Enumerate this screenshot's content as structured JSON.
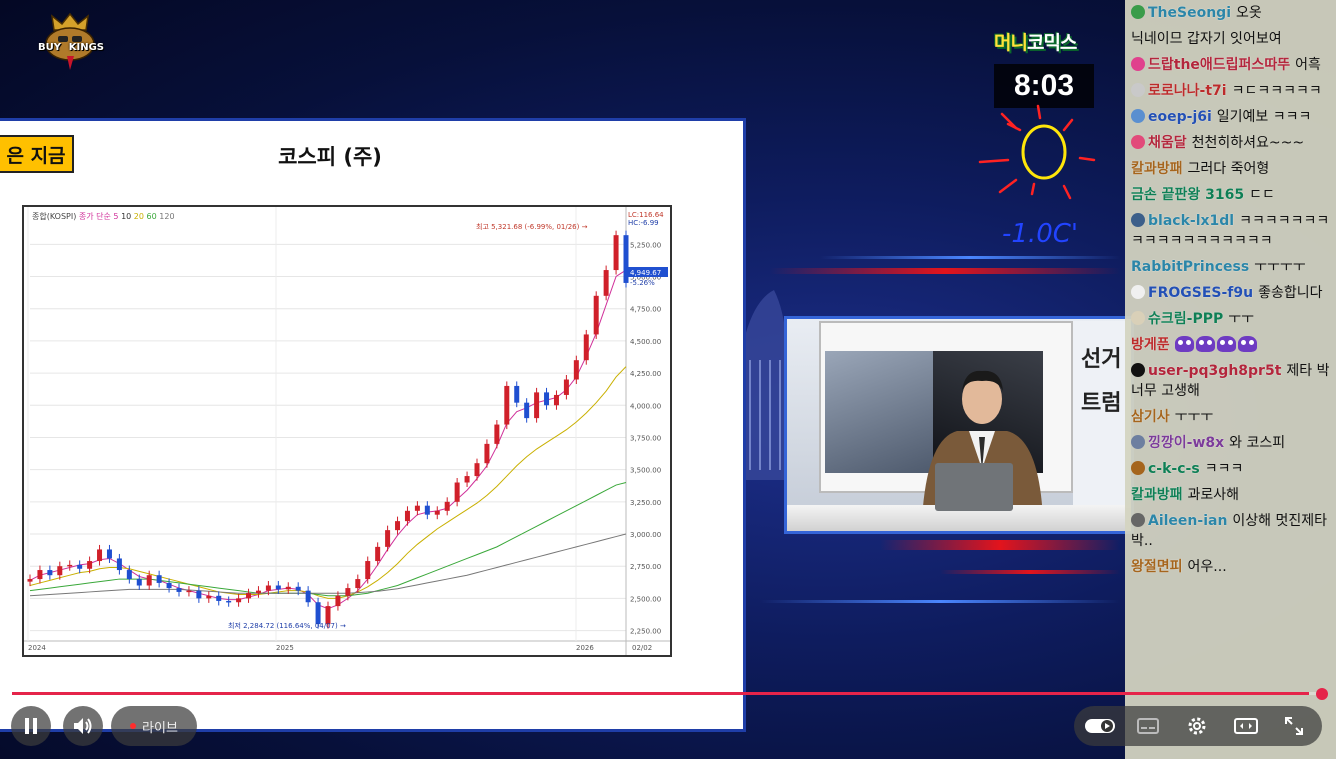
{
  "channel": {
    "logo_left": "BUY",
    "logo_right": "KINGS",
    "brand_prefix": "머니",
    "brand_suffix": "코믹스",
    "clock": "8:03"
  },
  "slide": {
    "tag": "은 지금",
    "title": "코스피 (주)",
    "legend": {
      "name": "종합(KOSPI)",
      "ma_label": "종가 단순",
      "ma5": "5",
      "ma10": "10",
      "ma20": "20",
      "ma60": "60",
      "ma120": "120"
    },
    "high_note": "최고 5,321.68 (-6.99%, 01/26) →",
    "low_note": "최저 2,284.72 (116.64%, 04/07) →",
    "top_right_1": "LC:116.64",
    "top_right_2": "HC:-6.99",
    "current_price": "4,949.67",
    "current_change": "-5.26%"
  },
  "chart_data": {
    "type": "line",
    "title": "코스피 (주)",
    "xlabel": "",
    "ylabel": "",
    "x_ticks": [
      "2024",
      "2025",
      "2026",
      "02/02"
    ],
    "y_ticks": [
      "5,250.00",
      "5,000.00",
      "4,750.00",
      "4,500.00",
      "4,250.00",
      "4,000.00",
      "3,750.00",
      "3,500.00",
      "3,250.00",
      "3,000.00",
      "2,750.00",
      "2,500.00",
      "2,250.00"
    ],
    "ylim": [
      2200,
      5400
    ],
    "grid": true,
    "series": [
      {
        "name": "종합(KOSPI)",
        "values": [
          2650,
          2720,
          2680,
          2750,
          2760,
          2730,
          2790,
          2880,
          2810,
          2720,
          2650,
          2600,
          2680,
          2620,
          2580,
          2550,
          2560,
          2500,
          2520,
          2480,
          2470,
          2500,
          2540,
          2560,
          2600,
          2570,
          2590,
          2560,
          2470,
          2300,
          2440,
          2520,
          2580,
          2650,
          2790,
          2900,
          3030,
          3100,
          3180,
          3220,
          3150,
          3180,
          3250,
          3400,
          3450,
          3550,
          3700,
          3850,
          4150,
          4020,
          3900,
          4100,
          4000,
          4080,
          4200,
          4350,
          4550,
          4850,
          5050,
          5321,
          4950
        ]
      },
      {
        "name": "5",
        "values": [
          2640,
          2680,
          2700,
          2720,
          2740,
          2760,
          2770,
          2800,
          2810,
          2770,
          2720,
          2670,
          2650,
          2640,
          2610,
          2580,
          2560,
          2540,
          2520,
          2500,
          2490,
          2490,
          2510,
          2530,
          2560,
          2570,
          2580,
          2570,
          2530,
          2450,
          2420,
          2450,
          2500,
          2560,
          2650,
          2760,
          2880,
          2990,
          3080,
          3150,
          3170,
          3180,
          3200,
          3270,
          3340,
          3430,
          3530,
          3680,
          3860,
          3950,
          3980,
          4020,
          4040,
          4060,
          4120,
          4220,
          4380,
          4560,
          4780,
          5000,
          5050
        ]
      },
      {
        "name": "20",
        "values": [
          2600,
          2620,
          2640,
          2660,
          2680,
          2700,
          2710,
          2730,
          2740,
          2740,
          2730,
          2710,
          2690,
          2670,
          2650,
          2630,
          2610,
          2590,
          2570,
          2550,
          2540,
          2530,
          2530,
          2530,
          2540,
          2550,
          2560,
          2560,
          2550,
          2520,
          2500,
          2500,
          2520,
          2550,
          2590,
          2640,
          2700,
          2770,
          2850,
          2920,
          2980,
          3040,
          3090,
          3140,
          3190,
          3240,
          3300,
          3370,
          3450,
          3530,
          3600,
          3660,
          3710,
          3760,
          3810,
          3870,
          3940,
          4020,
          4110,
          4220,
          4300
        ]
      },
      {
        "name": "60",
        "values": [
          2560,
          2570,
          2580,
          2590,
          2600,
          2610,
          2620,
          2630,
          2640,
          2650,
          2650,
          2650,
          2650,
          2640,
          2630,
          2620,
          2610,
          2600,
          2590,
          2580,
          2570,
          2560,
          2550,
          2540,
          2540,
          2540,
          2540,
          2540,
          2540,
          2530,
          2520,
          2520,
          2520,
          2530,
          2540,
          2560,
          2580,
          2600,
          2630,
          2660,
          2690,
          2720,
          2750,
          2780,
          2810,
          2840,
          2870,
          2900,
          2940,
          2980,
          3020,
          3060,
          3100,
          3140,
          3180,
          3220,
          3260,
          3300,
          3340,
          3380,
          3400
        ]
      },
      {
        "name": "120",
        "values": [
          2520,
          2525,
          2530,
          2535,
          2540,
          2545,
          2550,
          2555,
          2560,
          2565,
          2570,
          2570,
          2570,
          2570,
          2570,
          2570,
          2565,
          2560,
          2555,
          2550,
          2545,
          2540,
          2540,
          2540,
          2540,
          2540,
          2540,
          2540,
          2540,
          2540,
          2540,
          2540,
          2540,
          2545,
          2550,
          2555,
          2565,
          2575,
          2590,
          2605,
          2620,
          2635,
          2650,
          2665,
          2680,
          2700,
          2720,
          2740,
          2760,
          2780,
          2800,
          2820,
          2840,
          2860,
          2880,
          2900,
          2920,
          2940,
          2960,
          2980,
          3000
        ]
      }
    ]
  },
  "studio": {
    "side_line1": "선거",
    "side_line2": "트럼"
  },
  "overlay": {
    "handwriting": "-1.0C'"
  },
  "chat": [
    {
      "nick": "TheSeongi",
      "text": "오옷",
      "color": "c",
      "avatar": "#3a9c4a"
    },
    {
      "nick": "",
      "text": "닉네이므 갑자기 잇어보여",
      "color": "c",
      "avatar": ""
    },
    {
      "nick": "드랍the애드립퍼스따뚜",
      "text": "어흑",
      "color": "r",
      "avatar": "#e0418d"
    },
    {
      "nick": "로로나나-t7i",
      "text": "ㅋㄷㅋㅋㅋㅋㅋ",
      "color": "k",
      "avatar": "#c9c9c9"
    },
    {
      "nick": "eoep-j6i",
      "text": "일기예보 ㅋㅋㅋ",
      "color": "b",
      "avatar": "#5a8fd0"
    },
    {
      "nick": "채움달",
      "text": "천천히하셔요~~~",
      "color": "r",
      "avatar": "#e24a7a"
    },
    {
      "nick": "칼과방패",
      "text": "그러다 죽어형",
      "color": "o",
      "avatar": ""
    },
    {
      "nick": "금손 끝판왕 3165",
      "text": "ㄷㄷ",
      "color": "g",
      "avatar": ""
    },
    {
      "nick": "black-lx1dl",
      "text": "ㅋㅋㅋㅋㅋㅋㅋㅋㅋㅋㅋㅋㅋㅋㅋㅋㅋㅋ",
      "color": "c",
      "avatar": "#3c5f8a"
    },
    {
      "nick": "RabbitPrincess",
      "text": "ㅜㅜㅜㅜ",
      "color": "c",
      "avatar": ""
    },
    {
      "nick": "FROGSES-f9u",
      "text": "좋송합니다",
      "color": "b",
      "avatar": "#f0f0f0"
    },
    {
      "nick": "슈크림-PPP",
      "text": "ㅜㅜ",
      "color": "g",
      "avatar": "#d9d0b8"
    },
    {
      "nick": "방게푼",
      "text": "",
      "color": "k",
      "avatar": "",
      "emotes": 4
    },
    {
      "nick": "user-pq3gh8pr5t",
      "text": "제타 박 너무 고생해",
      "color": "r",
      "avatar": "#111111"
    },
    {
      "nick": "삼기사",
      "text": "ㅜㅜㅜ",
      "color": "o",
      "avatar": ""
    },
    {
      "nick": "낑깡이-w8x",
      "text": "와 코스피",
      "color": "p",
      "avatar": "#6d7fa0"
    },
    {
      "nick": "c-k-c-s",
      "text": "ㅋㅋㅋ",
      "color": "g",
      "avatar": "#a5651d"
    },
    {
      "nick": "칼과방패",
      "text": "과로사해",
      "color": "g",
      "avatar": ""
    },
    {
      "nick": "Aileen-ian",
      "text": "이상해 멋진제타박..",
      "color": "c",
      "avatar": "#666666"
    },
    {
      "nick": "왕절면피",
      "text": "어우...",
      "color": "o",
      "avatar": ""
    }
  ],
  "player": {
    "live_label": "라이브",
    "progress": 0.99
  }
}
